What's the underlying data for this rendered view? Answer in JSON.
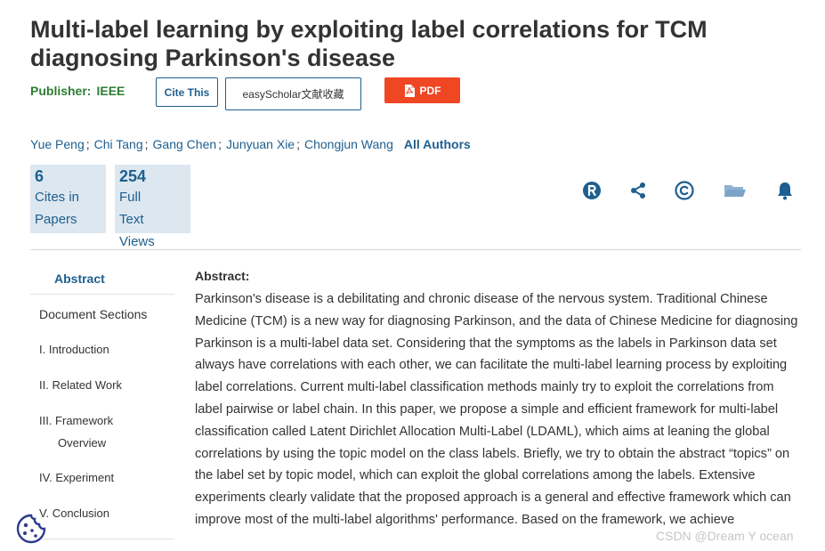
{
  "paper": {
    "title": "Multi-label learning by exploiting label correlations for TCM diagnosing Parkinson's disease",
    "publisher_label": "Publisher:",
    "publisher_value": "IEEE"
  },
  "buttons": {
    "cite": "Cite This",
    "easyscholar": "easyScholar文献收藏",
    "pdf": "PDF"
  },
  "authors": [
    "Yue Peng",
    "Chi Tang",
    "Gang Chen",
    "Junyuan Xie",
    "Chongjun Wang"
  ],
  "author_separator": ";",
  "all_authors": "All Authors",
  "metrics": [
    {
      "value": "6",
      "label_lines": [
        "Cites in",
        "Papers"
      ]
    },
    {
      "value": "254",
      "label_lines": [
        "Full",
        "Text",
        "Views"
      ]
    }
  ],
  "action_icons": [
    "rights-icon",
    "share-icon",
    "copyright-icon",
    "folder-icon",
    "bell-icon"
  ],
  "sidebar": {
    "abstract": "Abstract",
    "document_sections": "Document Sections",
    "items": [
      {
        "lines": [
          "I.  Introduction"
        ]
      },
      {
        "lines": [
          "II.  Related Work"
        ]
      },
      {
        "lines": [
          "III.  Framework",
          "Overview"
        ]
      },
      {
        "lines": [
          "IV.  Experiment"
        ]
      },
      {
        "lines": [
          "V.  Conclusion"
        ]
      }
    ]
  },
  "abstract": {
    "label": "Abstract:",
    "text": "Parkinson's disease is a debilitating and chronic disease of the nervous system. Traditional Chinese Medicine (TCM) is a new way for diagnosing Parkinson, and the data of Chinese Medicine for diagnosing Parkinson is a multi-label data set. Considering that the symptoms as the labels in Parkinson data set always have correlations with each other, we can facilitate the multi-label learning process by exploiting label correlations. Current multi-label classification methods mainly try to exploit the correlations from label pairwise or label chain. In this paper, we propose a simple and efficient framework for multi-label classification called Latent Dirichlet Allocation Multi-Label (LDAML), which aims at leaning the global correlations by using the topic model on the class labels. Briefly, we try to obtain the abstract “topics” on the label set by topic model, which can exploit the global correlations among the labels. Extensive experiments clearly validate that the proposed approach is a general and effective framework which can improve most of the multi-label algorithms' performance. Based on the framework, we achieve"
  },
  "watermark": "CSDN @Dream Y ocean",
  "colors": {
    "link": "#1e5f8f",
    "publisher": "#2e7d32",
    "pdf_button": "#ef4623",
    "metric_bg": "#dde7f0"
  }
}
